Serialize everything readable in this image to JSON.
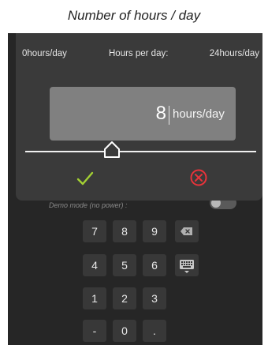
{
  "caption": "Number of hours / day",
  "dialog": {
    "range_min": "0hours/day",
    "title": "Hours per day:",
    "range_max": "24hours/day",
    "value": "8",
    "unit": "hours/day",
    "slider_value": 8,
    "slider_min": 0,
    "slider_max": 24
  },
  "demo": {
    "label": "Demo mode (no power) :",
    "toggle_on": false
  },
  "keypad": {
    "row1": [
      "7",
      "8",
      "9"
    ],
    "row2": [
      "4",
      "5",
      "6"
    ],
    "row3": [
      "1",
      "2",
      "3"
    ],
    "row4": [
      "-",
      "0",
      "."
    ],
    "backspace_icon": "backspace-icon",
    "keyboard_icon": "keyboard-icon"
  },
  "colors": {
    "ok": "#a3d033",
    "cancel": "#e8333a"
  }
}
